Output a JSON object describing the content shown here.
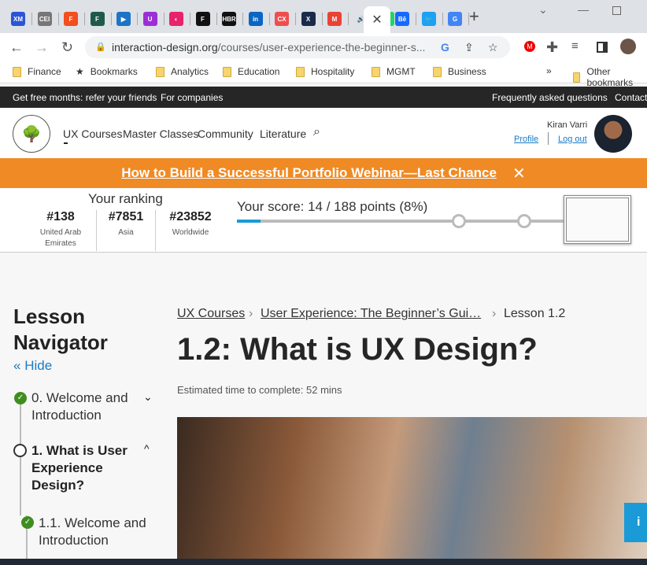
{
  "browser": {
    "tabs": [
      {
        "icon": "xm-icon",
        "label": "XM",
        "color": "#2b55d6"
      },
      {
        "icon": "cei-icon",
        "label": "CEI",
        "color": "#777"
      },
      {
        "icon": "figma-icon",
        "label": "F",
        "color": "#f24e1e"
      },
      {
        "icon": "f-icon",
        "label": "F",
        "color": "#1e5a4a"
      },
      {
        "icon": "video-icon",
        "label": "▶",
        "color": "#1d74c4"
      },
      {
        "icon": "u-icon",
        "label": "U",
        "color": "#9b2fd6"
      },
      {
        "icon": "pink-icon",
        "label": "◐",
        "color": "#e8236c"
      },
      {
        "icon": "f-black-icon",
        "label": "F",
        "color": "#111"
      },
      {
        "icon": "hbr-icon",
        "label": "HBR",
        "color": "#111"
      },
      {
        "icon": "linkedin-icon",
        "label": "in",
        "color": "#0a66c2"
      },
      {
        "icon": "cx-icon",
        "label": "CX",
        "color": "#f04e4e"
      },
      {
        "icon": "x-dark-icon",
        "label": "X",
        "color": "#1a2a4a"
      },
      {
        "icon": "gmail-icon",
        "label": "M",
        "color": "#ea4335"
      },
      {
        "icon": "audio-icon",
        "label": "🔊",
        "color": "#dee1e6"
      },
      {
        "icon": "whatsapp-icon",
        "label": "✆",
        "color": "#25d366"
      }
    ],
    "tabs_after": [
      {
        "icon": "behance-icon",
        "label": "Bē",
        "color": "#1769ff"
      },
      {
        "icon": "twitter-icon",
        "label": "🐦",
        "color": "#1da1f2"
      },
      {
        "icon": "google-icon",
        "label": "G",
        "color": "#4285f4"
      }
    ],
    "url_domain": "interaction-design.org",
    "url_path": "/courses/user-experience-the-beginner-s...",
    "bookmarks": [
      "Finance",
      "Bookmarks",
      "Analytics",
      "Education",
      "Hospitality",
      "MGMT",
      "Business"
    ],
    "other_bookmarks": "Other bookmarks"
  },
  "topbar": {
    "refer": "Get free months: refer your friends",
    "companies": "For companies",
    "faq": "Frequently asked questions",
    "contact": "Contact"
  },
  "header": {
    "nav": [
      "UX Courses",
      "Master Classes",
      "Community",
      "Literature"
    ],
    "user": "Kiran Varri",
    "profile": "Profile",
    "logout": "Log out"
  },
  "banner": {
    "text": "How to Build a Successful Portfolio Webinar—Last Chance"
  },
  "ranking": {
    "title": "Your ranking",
    "items": [
      {
        "rank": "#138",
        "region": "United Arab Emirates"
      },
      {
        "rank": "#7851",
        "region": "Asia"
      },
      {
        "rank": "#23852",
        "region": "Worldwide"
      }
    ]
  },
  "score": {
    "text": "Your score: 14 / 188 points (8%)",
    "percent": 8
  },
  "sidebar": {
    "title": "Lesson Navigator",
    "hide": "Hide",
    "items": [
      {
        "label": "0. Welcome and Introduction",
        "status": "complete"
      },
      {
        "label": "1. What is User Experience Design?",
        "status": "current"
      },
      {
        "label": "1.1. Welcome and Introduction",
        "status": "complete"
      }
    ]
  },
  "breadcrumb": [
    "UX Courses",
    "User Experience: The Beginner’s Gui…",
    "Lesson 1.2"
  ],
  "lesson": {
    "title": "1.2: What is UX Design?",
    "estimate": "Estimated time to complete: 52 mins"
  },
  "colors": {
    "accent_orange": "#f08a24",
    "progress_blue": "#1a9ad6",
    "check_green": "#3e8e1f"
  }
}
